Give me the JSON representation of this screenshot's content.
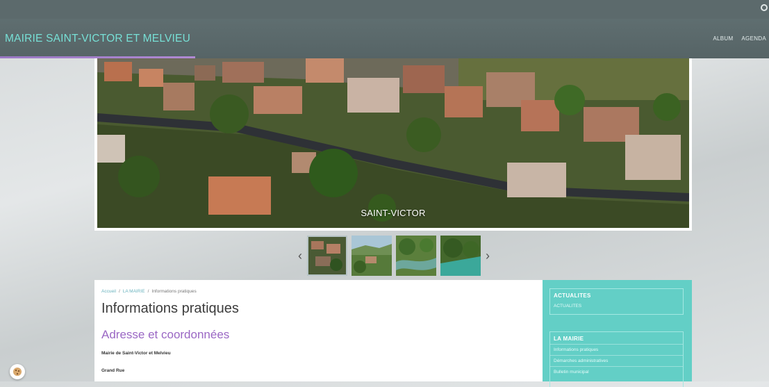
{
  "site": {
    "title": "MAIRIE SAINT-VICTOR ET MELVIEU"
  },
  "nav": {
    "items": [
      "ALBUM",
      "AGENDA"
    ]
  },
  "hero": {
    "caption": "SAINT-VICTOR"
  },
  "carousel": {
    "prev_glyph": "‹",
    "next_glyph": "›",
    "thumb_count": 4,
    "active_index": 0
  },
  "breadcrumb": {
    "items": [
      "Accueil",
      "LA MAIRIE",
      "Informations pratiques"
    ],
    "separator": "/"
  },
  "page": {
    "title": "Informations pratiques",
    "section_title": "Adresse et coordonnées",
    "address_line1": "Mairie de Saint-Victor et Melvieu",
    "address_line2": "Grand Rue"
  },
  "sidebar": {
    "actualites": {
      "title": "ACTUALITES",
      "items": [
        "ACTUALITES"
      ]
    },
    "la_mairie": {
      "title": "LA MAIRIE",
      "items": [
        "Informations pratiques",
        "Démarches administratives",
        "Bulletin municipal"
      ]
    }
  },
  "colors": {
    "accent": "#77e0d6",
    "purple": "#9a67c4",
    "sidebar": "#63cfc6",
    "header": "#5c6a6c"
  },
  "icons": {
    "search": "search-icon",
    "cookie": "cookie-icon"
  }
}
